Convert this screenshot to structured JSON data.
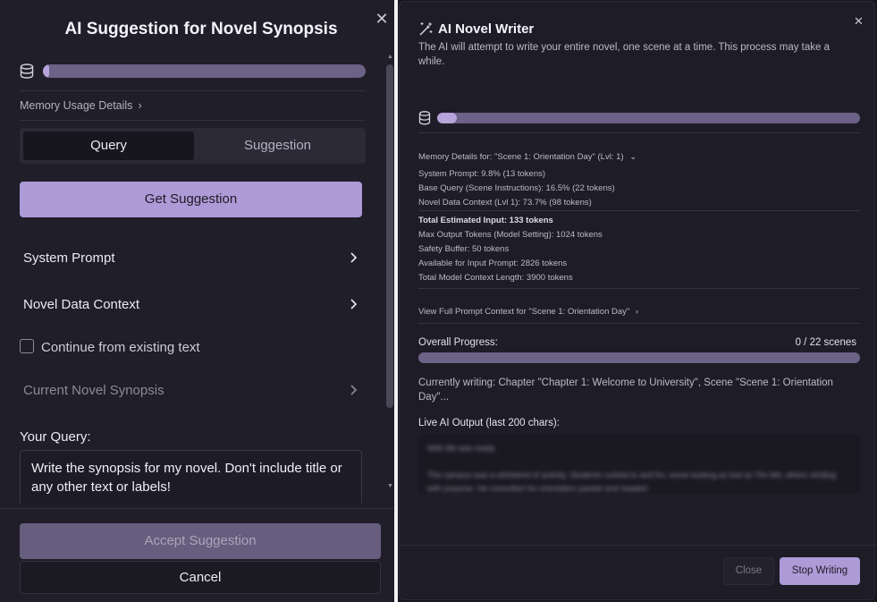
{
  "left_dialog": {
    "title": "AI Suggestion for Novel Synopsis",
    "close_icon": "close-icon",
    "memory_fill_fraction": 0.02,
    "memory_details_link": "Memory Usage Details",
    "tabs": [
      {
        "label": "Query",
        "active": true
      },
      {
        "label": "Suggestion",
        "active": false
      }
    ],
    "get_suggestion_label": "Get Suggestion",
    "sections": [
      {
        "label": "System Prompt"
      },
      {
        "label": "Novel Data Context"
      }
    ],
    "continue_checkbox_label": "Continue from existing text",
    "continue_checked": false,
    "current_synopsis_label": "Current Novel Synopsis",
    "your_query_label": "Your Query:",
    "query_text": "Write the synopsis for my novel. Don't include title or any other text or labels!",
    "accept_label": "Accept Suggestion",
    "cancel_label": "Cancel"
  },
  "right_dialog": {
    "title": "AI Novel Writer",
    "description": "The AI will attempt to write your entire novel, one scene at a time. This process may take a while.",
    "memory_fill_fraction": 0.047,
    "memory_details_title": "Memory Details for: \"Scene 1: Orientation Day\" (Lvl: 1)",
    "breakdown": [
      "System Prompt: 9.8% (13 tokens)",
      "Base Query (Scene Instructions): 16.5% (22 tokens)",
      "Novel Data Context (Lvl 1): 73.7% (98 tokens)"
    ],
    "totals": [
      {
        "text": "Total Estimated Input: 133 tokens",
        "bold": true
      },
      {
        "text": "Max Output Tokens (Model Setting): 1024 tokens",
        "bold": false
      },
      {
        "text": "Safety Buffer: 50 tokens",
        "bold": false
      },
      {
        "text": "Available for Input Prompt: 2826 tokens",
        "bold": false
      },
      {
        "text": "Total Model Context Length: 3900 tokens",
        "bold": false
      }
    ],
    "view_full_prompt_link": "View Full Prompt Context for \"Scene 1: Orientation Day\"",
    "overall_progress_label": "Overall Progress:",
    "progress_count": "0 / 22 scenes",
    "progress_fraction": 0,
    "currently_writing": "Currently writing: Chapter \"Chapter 1: Welcome to University\", Scene \"Scene 1: Orientation Day\"...",
    "live_output_label": "Live AI Output (last 200 chars):",
    "live_output_text": "With life was ready\n\nThe campus was a whirlwind of activity. Students rushed to and fro, some looking as lost as Tim felt, others striding with purpose. He consulted his orientation packet and headed",
    "close_label": "Close",
    "stop_label": "Stop Writing"
  },
  "colors": {
    "accent": "#ae9ad6",
    "bar_track": "#6c6186",
    "bar_fill": "#b7a4da",
    "panel_bg": "#1f1e29"
  }
}
